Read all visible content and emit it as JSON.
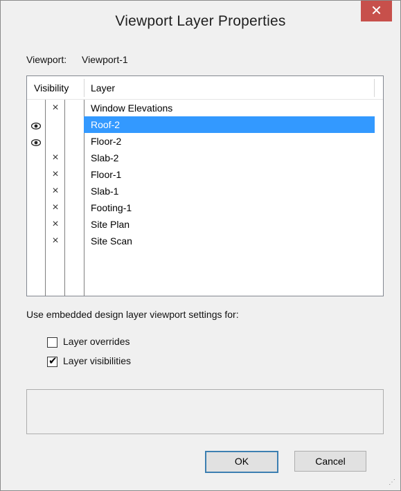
{
  "window": {
    "title": "Viewport Layer Properties",
    "close_glyph": "✕"
  },
  "viewport": {
    "label": "Viewport:",
    "value": "Viewport-1"
  },
  "list": {
    "columns": [
      "Visibility",
      "Layer"
    ],
    "rows": [
      {
        "eye": false,
        "x": "×",
        "layer": "Window Elevations",
        "selected": false
      },
      {
        "eye": true,
        "x": "",
        "layer": "Roof-2",
        "selected": true
      },
      {
        "eye": true,
        "x": "",
        "layer": "Floor-2",
        "selected": false
      },
      {
        "eye": false,
        "x": "×",
        "layer": "Slab-2",
        "selected": false
      },
      {
        "eye": false,
        "x": "×",
        "layer": "Floor-1",
        "selected": false
      },
      {
        "eye": false,
        "x": "×",
        "layer": "Slab-1",
        "selected": false
      },
      {
        "eye": false,
        "x": "×",
        "layer": "Footing-1",
        "selected": false
      },
      {
        "eye": false,
        "x": "×",
        "layer": "Site Plan",
        "selected": false
      },
      {
        "eye": false,
        "x": "×",
        "layer": "Site Scan",
        "selected": false
      }
    ]
  },
  "embedded": {
    "label": "Use embedded design layer viewport settings for:",
    "options": [
      {
        "label": "Layer overrides",
        "checked": false
      },
      {
        "label": "Layer visibilities",
        "checked": true
      }
    ]
  },
  "buttons": {
    "ok": "OK",
    "cancel": "Cancel"
  },
  "colors": {
    "selection": "#3399ff",
    "close_button": "#c7504b"
  },
  "icons": {
    "visible": "eye-icon",
    "hidden": "x-icon",
    "close": "close-icon",
    "check": "checkmark-icon"
  }
}
